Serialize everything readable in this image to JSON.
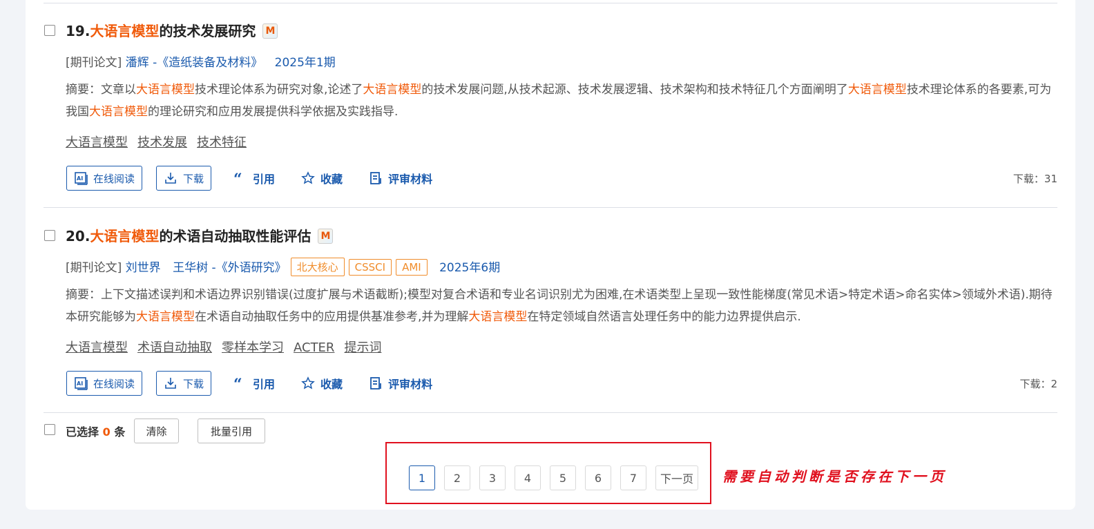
{
  "results": [
    {
      "number": "19.",
      "title_highlight": "大语言模型",
      "title_rest": "的技术发展研究",
      "m_badge": "M",
      "doc_type": "[期刊论文]",
      "authors": [
        "潘辉"
      ],
      "source": "-《造纸装备及材料》",
      "tags": [],
      "issue": "2025年1期",
      "abstract": [
        {
          "t": "摘要：文章以"
        },
        {
          "t": "大语言模型",
          "h": true
        },
        {
          "t": "技术理论体系为研究对象,论述了"
        },
        {
          "t": "大语言模型",
          "h": true
        },
        {
          "t": "的技术发展问题,从技术起源、技术发展逻辑、技术架构和技术特征几个方面阐明了"
        },
        {
          "t": "大语言模型",
          "h": true
        },
        {
          "t": "技术理论体系的各要素,可为我国"
        },
        {
          "t": "大语言模型",
          "h": true
        },
        {
          "t": "的理论研究和应用发展提供科学依据及实践指导."
        }
      ],
      "keywords": [
        "大语言模型",
        "技术发展",
        "技术特征"
      ],
      "downloads": "下载：31"
    },
    {
      "number": "20.",
      "title_highlight": "大语言模型",
      "title_rest": "的术语自动抽取性能评估",
      "m_badge": "M",
      "doc_type": "[期刊论文]",
      "authors": [
        "刘世界",
        "王华树"
      ],
      "source": "-《外语研究》",
      "tags": [
        "北大核心",
        "CSSCI",
        "AMI"
      ],
      "issue": "2025年6期",
      "abstract": [
        {
          "t": "摘要：上下文描述误判和术语边界识别错误(过度扩展与术语截断);模型对复合术语和专业名词识别尤为困难,在术语类型上呈现一致性能梯度(常见术语>特定术语>命名实体>领域外术语).期待本研究能够为"
        },
        {
          "t": "大语言模型",
          "h": true
        },
        {
          "t": "在术语自动抽取任务中的应用提供基准参考,并为理解"
        },
        {
          "t": "大语言模型",
          "h": true
        },
        {
          "t": "在特定领域自然语言处理任务中的能力边界提供启示."
        }
      ],
      "keywords": [
        "大语言模型",
        "术语自动抽取",
        "零样本学习",
        "ACTER",
        "提示词"
      ],
      "downloads": "下载：2"
    }
  ],
  "actions": {
    "read_online": "在线阅读",
    "download": "下载",
    "cite": "引用",
    "favorite": "收藏",
    "review": "评审材料"
  },
  "footer": {
    "selected_prefix": "已选择",
    "selected_count": "0",
    "selected_suffix": "条",
    "clear": "清除",
    "batch_cite": "批量引用"
  },
  "pagination": {
    "pages": [
      "1",
      "2",
      "3",
      "4",
      "5",
      "6",
      "7"
    ],
    "current": "1",
    "next": "下一页"
  },
  "annotation": "需要自动判断是否存在下一页",
  "colors": {
    "highlight": "#f05a0a",
    "link": "#1a5aad",
    "annotation": "#e0101e"
  }
}
